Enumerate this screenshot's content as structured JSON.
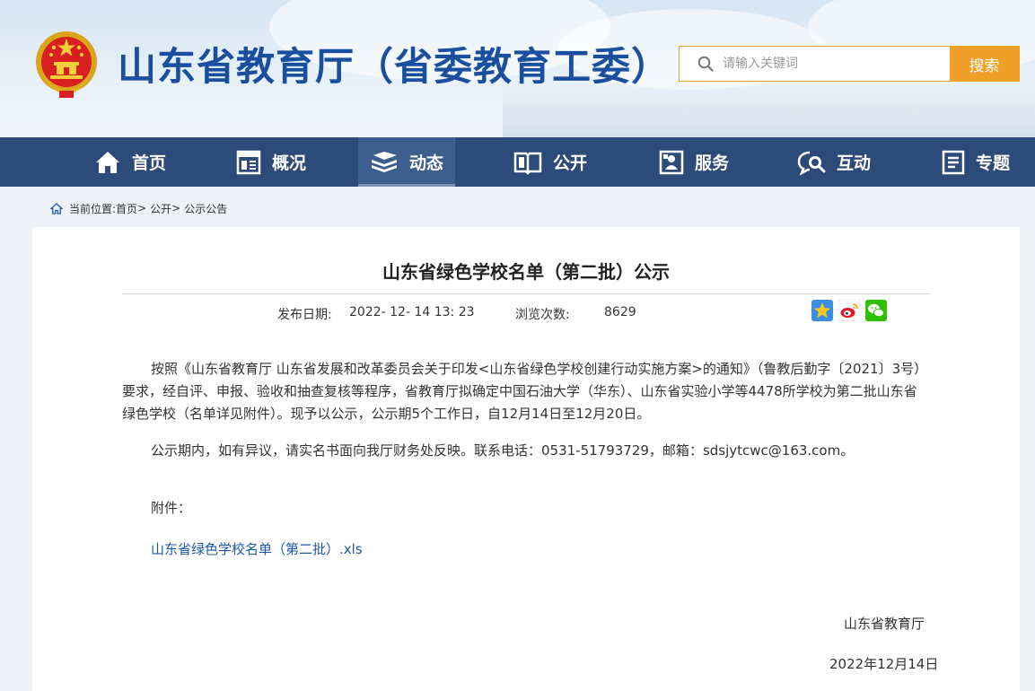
{
  "header": {
    "site_title": "山东省教育厅（省委教育工委）",
    "search": {
      "placeholder": "请输入关键词",
      "button_label": "搜索"
    }
  },
  "nav": {
    "items": [
      {
        "label": "首页",
        "icon": "home-icon"
      },
      {
        "label": "概况",
        "icon": "overview-icon"
      },
      {
        "label": "动态",
        "icon": "news-stack-icon",
        "active": true
      },
      {
        "label": "公开",
        "icon": "open-book-icon"
      },
      {
        "label": "服务",
        "icon": "service-person-icon"
      },
      {
        "label": "互动",
        "icon": "chat-search-icon"
      },
      {
        "label": "专题",
        "icon": "topic-doc-icon"
      }
    ]
  },
  "breadcrumb": {
    "prefix": "当前位置:",
    "items": [
      "首页",
      "公开",
      "公示公告"
    ],
    "separator": ">"
  },
  "article": {
    "title": "山东省绿色学校名单（第二批）公示",
    "publish_label": "发布日期:",
    "publish_date": "2022- 12- 14 13: 23",
    "views_label": "浏览次数:",
    "views": "8629",
    "share_icons": [
      "qzone-star-icon",
      "weibo-icon",
      "wechat-icon"
    ],
    "paragraph1": "按照《山东省教育厅 山东省发展和改革委员会关于印发<山东省绿色学校创建行动实施方案>的通知》（鲁教后勤字〔2021〕3号）要求，经自评、申报、验收和抽查复核等程序，省教育厅拟确定中国石油大学（华东）、山东省实验小学等4478所学校为第二批山东省绿色学校（名单详见附件）。现予以公示，公示期5个工作日，自12月14日至12月20日。",
    "paragraph2": "公示期内，如有异议，请实名书面向我厅财务处反映。联系电话：0531-51793729，邮箱：sdsjytcwc@163.com。",
    "attachment_label": "附件：",
    "attachment_link": "山东省绿色学校名单（第二批）.xls",
    "sign_org": "山东省教育厅",
    "sign_date": "2022年12月14日"
  },
  "colors": {
    "title_blue": "#1a4fa0",
    "nav_bg": "#2d4b78",
    "search_accent": "#f0a027",
    "link_blue": "#1c5aa8"
  }
}
